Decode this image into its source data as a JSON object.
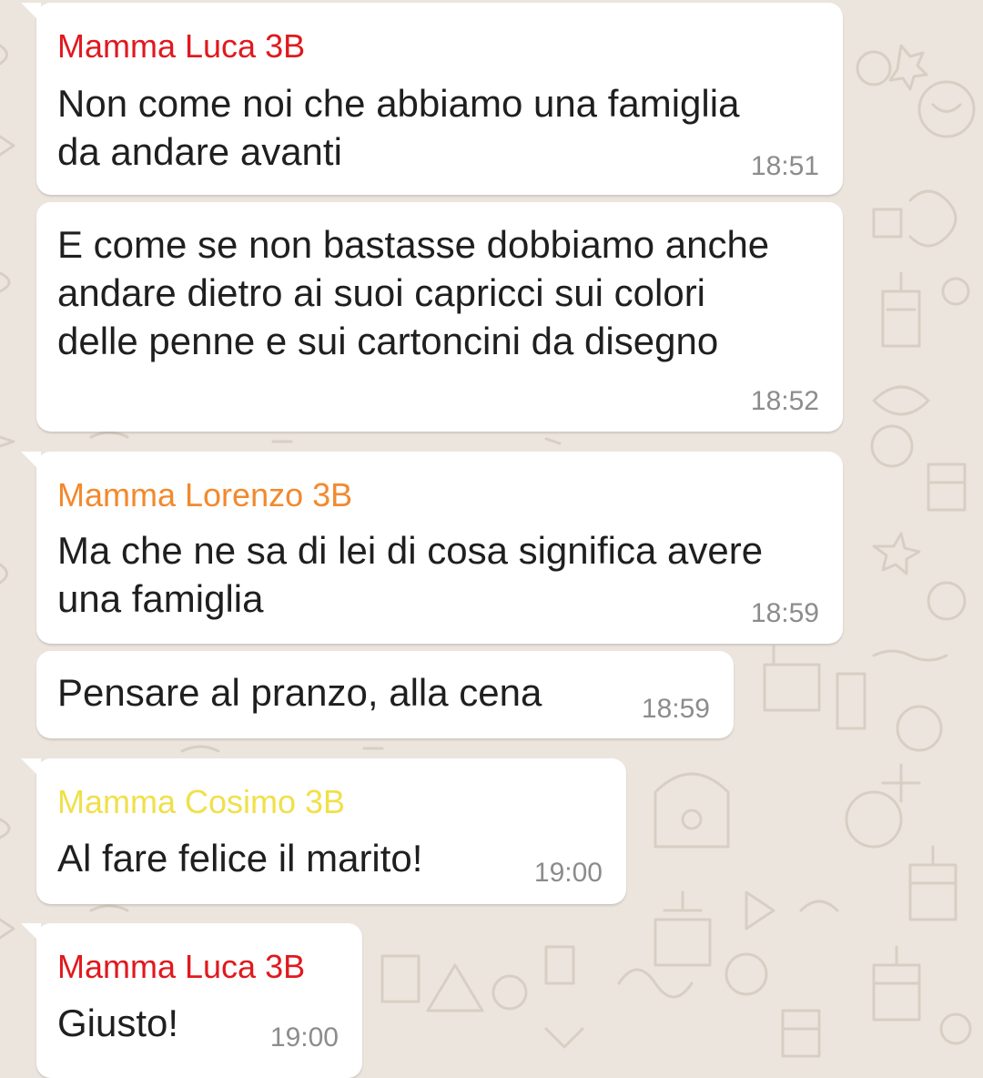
{
  "colors": {
    "background": "#ECE5DD",
    "bubble": "#FFFFFF",
    "text": "#1F1F1F",
    "time": "#8C8C8C",
    "sender_luca": "#E0191E",
    "sender_lorenzo": "#F2892E",
    "sender_cosimo": "#F0E04A"
  },
  "messages": [
    {
      "sender": "Mamma Luca 3B",
      "text": "Non come noi che abbiamo una famiglia\nda andare avanti",
      "time": "18:51"
    },
    {
      "text": "E come se non bastasse dobbiamo anche\nandare dietro ai suoi capricci sui colori\ndelle penne e sui cartoncini da disegno",
      "time": "18:52"
    },
    {
      "sender": "Mamma Lorenzo 3B",
      "text": "Ma che ne sa di lei di cosa significa avere\nuna famiglia",
      "time": "18:59"
    },
    {
      "text": "Pensare al pranzo, alla cena",
      "time": "18:59"
    },
    {
      "sender": "Mamma Cosimo 3B",
      "text": "Al fare felice il marito!",
      "time": "19:00"
    },
    {
      "sender": "Mamma Luca 3B",
      "text": "Giusto!",
      "time": "19:00"
    }
  ]
}
